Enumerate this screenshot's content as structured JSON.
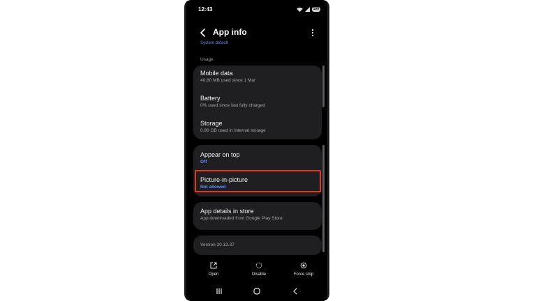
{
  "status_bar": {
    "time": "12:43",
    "battery": "100"
  },
  "header": {
    "title": "App info"
  },
  "partial_top": {
    "text": "System default"
  },
  "usage": {
    "section_label": "Usage",
    "items": [
      {
        "title": "Mobile data",
        "subtitle": "40.80 MB used since 1 Mar"
      },
      {
        "title": "Battery",
        "subtitle": "0% used since last fully charged"
      },
      {
        "title": "Storage",
        "subtitle": "0.96 GB used in Internal storage"
      }
    ]
  },
  "permissions": {
    "items": [
      {
        "title": "Appear on top",
        "subtitle": "Off"
      },
      {
        "title": "Picture-in-picture",
        "subtitle": "Not allowed"
      }
    ]
  },
  "store": {
    "title": "App details in store",
    "subtitle": "App downloaded from Google Play Store"
  },
  "version": {
    "text": "Version 20.13.37"
  },
  "actions": {
    "open": "Open",
    "disable": "Disable",
    "force_stop": "Force stop"
  },
  "colors": {
    "background": "#000000",
    "card": "#1f1f21",
    "accent": "#5a8cff",
    "highlight": "#e0391f"
  }
}
